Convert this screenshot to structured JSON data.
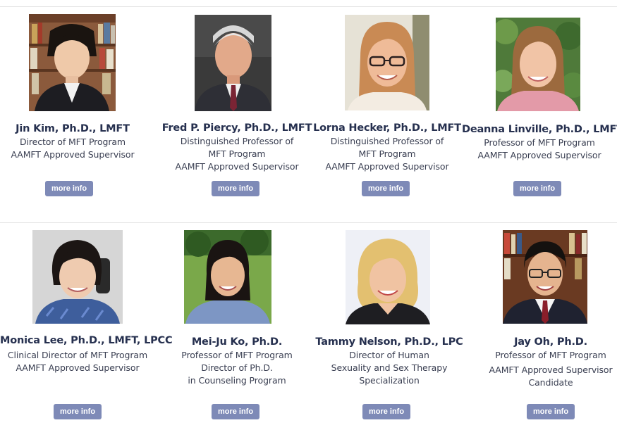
{
  "button_color": "#7e8ab7",
  "name_color": "#26304f",
  "people": [
    {
      "name": "Jin Kim, Ph.D., LMFT",
      "lines": [
        "Director of MFT Program",
        "AAMFT Approved Supervisor"
      ],
      "button": "more info",
      "photo": "portrait-woman-bookshelf"
    },
    {
      "name": "Fred P. Piercy, Ph.D., LMFT",
      "lines": [
        "Distinguished Professor of",
        "MFT Program",
        "AAMFT Approved Supervisor"
      ],
      "button": "more info",
      "photo": "portrait-man-gray-hair"
    },
    {
      "name": "Lorna Hecker, Ph.D., LMFT",
      "lines": [
        "Distinguished Professor of",
        "MFT Program",
        "AAMFT Approved Supervisor"
      ],
      "button": "more info",
      "photo": "portrait-woman-glasses"
    },
    {
      "name": "Deanna Linville, Ph.D., LMFT",
      "lines": [
        "Professor of MFT Program",
        "AAMFT Approved Supervisor"
      ],
      "button": "more info",
      "photo": "portrait-woman-outdoor"
    },
    {
      "name": "Monica Lee, Ph.D., LMFT, LPCC",
      "lines": [
        "Clinical Director of MFT Program",
        "AAMFT Approved Supervisor"
      ],
      "button": "more info",
      "photo": "portrait-woman-office"
    },
    {
      "name": "Mei-Ju Ko, Ph.D.",
      "lines": [
        "Professor of MFT Program",
        "Director of Ph.D.",
        "in Counseling Program"
      ],
      "button": "more info",
      "photo": "portrait-woman-park"
    },
    {
      "name": "Tammy Nelson, Ph.D., LPC",
      "lines": [
        "Director of Human",
        "Sexuality and Sex Therapy",
        "Specialization"
      ],
      "button": "more info",
      "photo": "portrait-woman-blonde"
    },
    {
      "name": "Jay Oh, Ph.D.",
      "lines": [
        "Professor of MFT Program",
        "AAMFT Approved Supervisor",
        "Candidate"
      ],
      "button": "more info",
      "photo": "portrait-man-glasses-bookshelf"
    }
  ]
}
